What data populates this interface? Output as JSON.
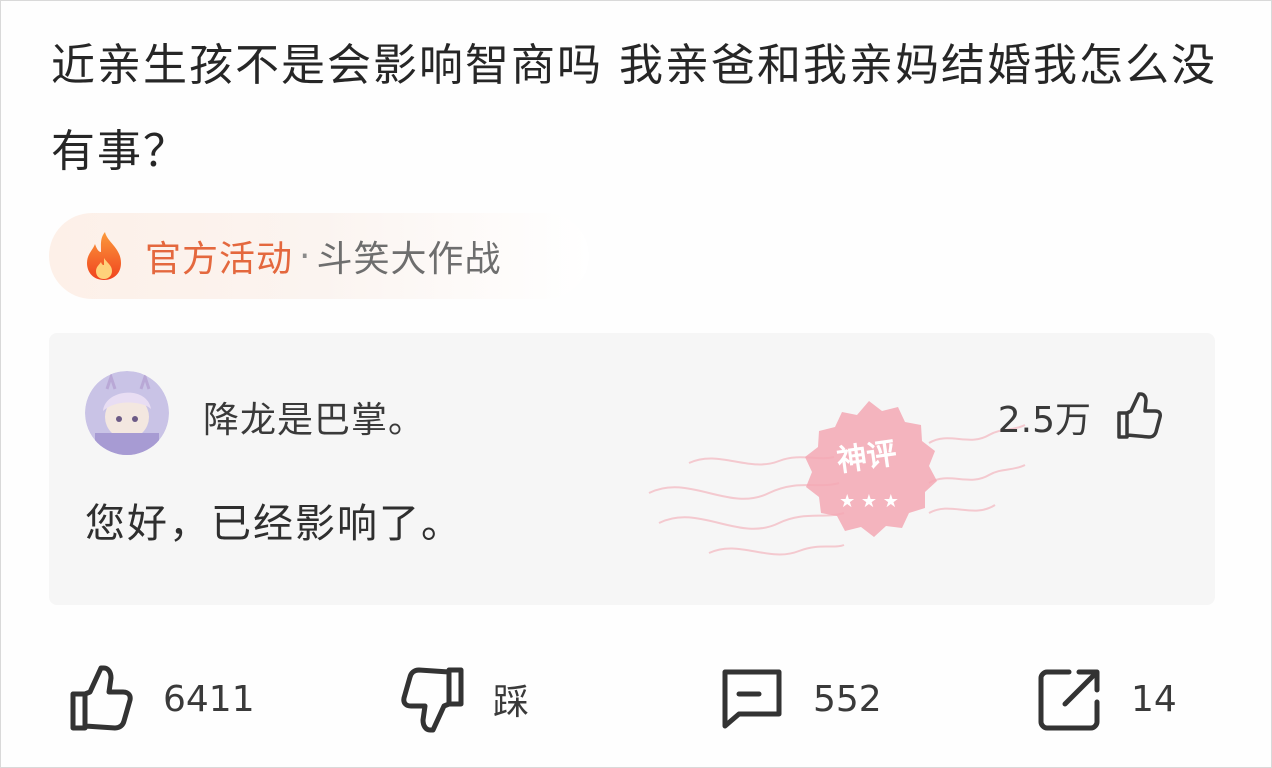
{
  "post": {
    "question": "近亲生孩不是会影响智商吗 我亲爸和我亲妈结婚我怎么没有事？"
  },
  "activity": {
    "icon": "fire-icon",
    "official_label": "官方活动",
    "separator": "·",
    "name": "斗笑大作战"
  },
  "top_comment": {
    "avatar": "avatar",
    "author": "降龙是巴掌。",
    "likes": "2.5万",
    "like_icon": "thumbs-up-icon",
    "text": "您好，已经影响了。",
    "stamp_label": "神评"
  },
  "actions": {
    "like_count": "6411",
    "dislike_label": "踩",
    "comment_count": "552",
    "share_count": "14"
  },
  "colors": {
    "accent": "#e4683e",
    "stamp": "#ec6f86",
    "card_bg": "#f6f6f6",
    "text": "#2b2b2b"
  }
}
